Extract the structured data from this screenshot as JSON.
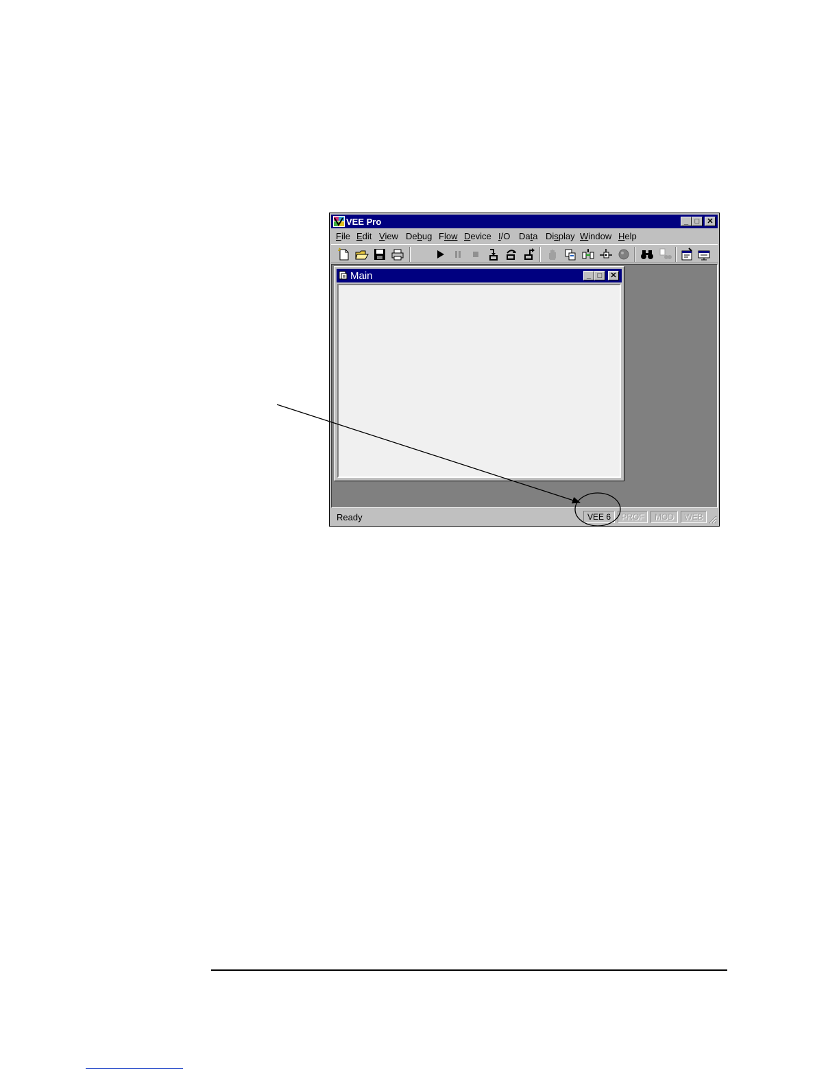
{
  "window": {
    "title": "VEE Pro"
  },
  "menu": [
    {
      "id": "file",
      "label": "File",
      "mnemonic": "F",
      "rest": "ile"
    },
    {
      "id": "edit",
      "label": "Edit",
      "mnemonic": "E",
      "rest": "dit"
    },
    {
      "id": "view",
      "label": "View",
      "mnemonic": "V",
      "rest": "iew"
    },
    {
      "id": "debug",
      "label": "Debug",
      "pre": "De",
      "mnemonic": "b",
      "rest": "ug"
    },
    {
      "id": "flow",
      "label": "Flow",
      "mnemonic": "F",
      "rest": "low",
      "pre": ""
    },
    {
      "id": "device",
      "label": "Device",
      "mnemonic": "D",
      "rest": "evice"
    },
    {
      "id": "io",
      "label": "I/O",
      "mnemonic": "I",
      "rest": "/O"
    },
    {
      "id": "data",
      "label": "Data",
      "pre": "Da",
      "mnemonic": "t",
      "rest": "a"
    },
    {
      "id": "display",
      "label": "Display",
      "pre": "Di",
      "mnemonic": "s",
      "rest": "play"
    },
    {
      "id": "window",
      "label": "Window",
      "mnemonic": "W",
      "rest": "indow"
    },
    {
      "id": "help",
      "label": "Help",
      "mnemonic": "H",
      "rest": "elp"
    }
  ],
  "toolbar_icons": [
    "new-icon",
    "open-icon",
    "save-icon",
    "print-icon",
    "run-icon",
    "pause-icon",
    "stop-icon",
    "step-into-icon",
    "step-over-icon",
    "step-out-icon",
    "hand-icon",
    "copy-icon",
    "connect-icon",
    "debug-icon",
    "circle-icon",
    "find-icon",
    "find-next-icon",
    "properties-icon",
    "monitor-icon"
  ],
  "main_window": {
    "title": "Main"
  },
  "status": {
    "text": "Ready",
    "panels": [
      {
        "label": "VEE 6",
        "active": true
      },
      {
        "label": "PROF",
        "active": false
      },
      {
        "label": "MOD",
        "active": false
      },
      {
        "label": "WEB",
        "active": false
      }
    ]
  }
}
